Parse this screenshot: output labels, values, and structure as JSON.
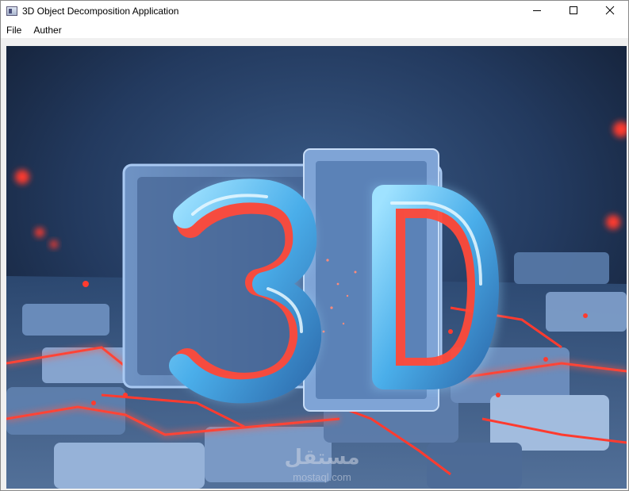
{
  "window": {
    "title": "3D Object Decomposition Application",
    "controls": {
      "minimize_icon": "minimize-icon",
      "maximize_icon": "maximize-icon",
      "close_icon": "close-icon"
    }
  },
  "menubar": {
    "items": [
      {
        "label": "File"
      },
      {
        "label": "Auther"
      }
    ]
  },
  "image": {
    "main_text": "3D",
    "watermark_arabic": "مستقل",
    "watermark_url": "mostaql.com"
  },
  "colors": {
    "background_dark": "#1b2a44",
    "neon_blue": "#5fc8ff",
    "neon_red": "#ff3b2f"
  }
}
